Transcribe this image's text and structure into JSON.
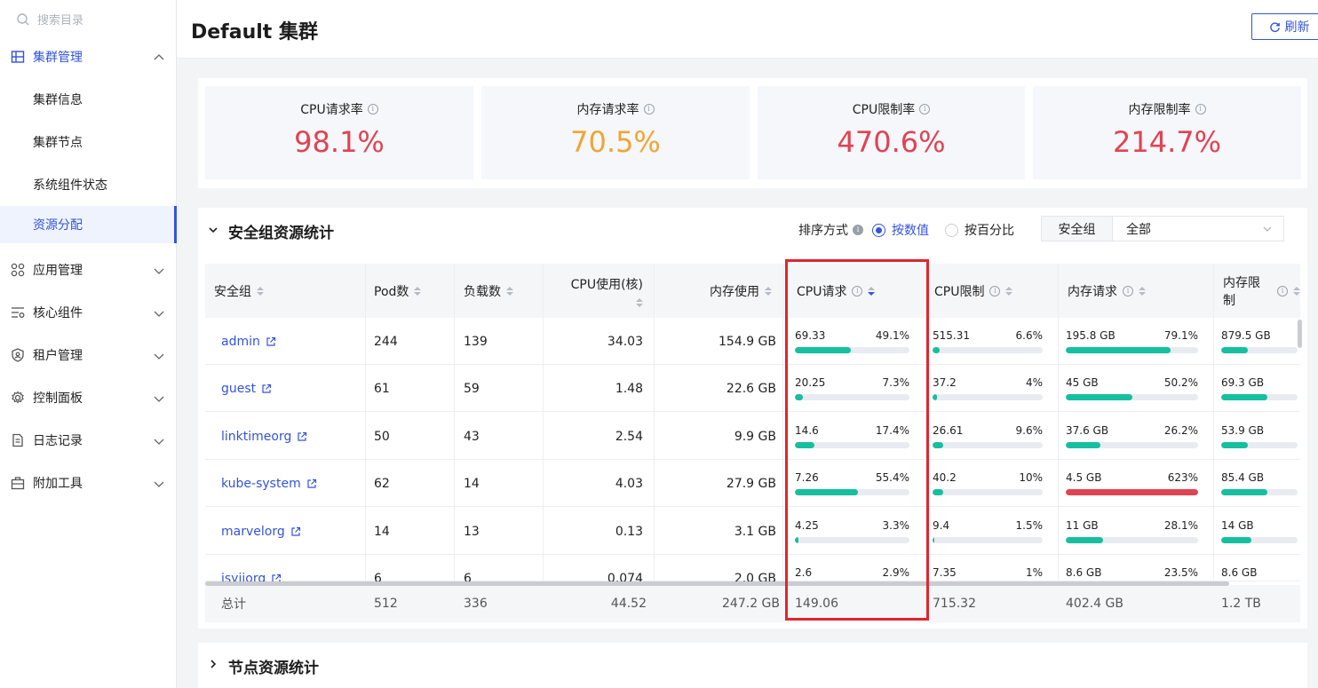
{
  "sidebar": {
    "search_placeholder": "搜索目录",
    "groups": [
      {
        "label": "集群管理",
        "icon": "cluster-icon",
        "expanded": true
      },
      {
        "label": "应用管理",
        "icon": "apps-icon"
      },
      {
        "label": "核心组件",
        "icon": "components-icon"
      },
      {
        "label": "租户管理",
        "icon": "tenant-shield-icon"
      },
      {
        "label": "控制面板",
        "icon": "gear-icon"
      },
      {
        "label": "日志记录",
        "icon": "log-doc-icon"
      },
      {
        "label": "附加工具",
        "icon": "toolbox-icon"
      }
    ],
    "sub_items": [
      "集群信息",
      "集群节点",
      "系统组件状态",
      "资源分配"
    ],
    "selected": "资源分配"
  },
  "header": {
    "title": "Default 集群",
    "refresh_label": "刷新"
  },
  "stats": [
    {
      "label": "CPU请求率",
      "value": "98.1%",
      "color": "#e04352"
    },
    {
      "label": "内存请求率",
      "value": "70.5%",
      "color": "#f0a533"
    },
    {
      "label": "CPU限制率",
      "value": "470.6%",
      "color": "#e04352"
    },
    {
      "label": "内存限制率",
      "value": "214.7%",
      "color": "#e04352"
    }
  ],
  "security_section": {
    "title": "安全组资源统计",
    "sort_label": "排序方式",
    "sort_options": [
      "按数值",
      "按百分比"
    ],
    "sort_selected": "按数值",
    "filter_label": "安全组",
    "filter_value": "全部"
  },
  "table": {
    "columns": [
      "安全组",
      "Pod数",
      "负载数",
      "CPU使用(核)",
      "内存使用",
      "CPU请求",
      "CPU限制",
      "内存请求",
      "内存限制"
    ],
    "rows": [
      {
        "name": "admin",
        "pods": "244",
        "loads": "139",
        "cpu_use": "34.03",
        "mem_use": "154.9 GB",
        "cpu_req": [
          "69.33",
          "49.1%",
          0.491
        ],
        "cpu_lim": [
          "515.31",
          "6.6%",
          0.066
        ],
        "mem_req": [
          "195.8 GB",
          "79.1%",
          0.791
        ],
        "mem_lim": [
          "879.5 GB",
          "",
          0.35
        ]
      },
      {
        "name": "guest",
        "pods": "61",
        "loads": "59",
        "cpu_use": "1.48",
        "mem_use": "22.6 GB",
        "cpu_req": [
          "20.25",
          "7.3%",
          0.073
        ],
        "cpu_lim": [
          "37.2",
          "4%",
          0.04
        ],
        "mem_req": [
          "45 GB",
          "50.2%",
          0.502
        ],
        "mem_lim": [
          "69.3 GB",
          "",
          0.6
        ]
      },
      {
        "name": "linktimeorg",
        "pods": "50",
        "loads": "43",
        "cpu_use": "2.54",
        "mem_use": "9.9 GB",
        "cpu_req": [
          "14.6",
          "17.4%",
          0.174
        ],
        "cpu_lim": [
          "26.61",
          "9.6%",
          0.096
        ],
        "mem_req": [
          "37.6 GB",
          "26.2%",
          0.262
        ],
        "mem_lim": [
          "53.9 GB",
          "",
          0.35
        ]
      },
      {
        "name": "kube-system",
        "pods": "62",
        "loads": "14",
        "cpu_use": "4.03",
        "mem_use": "27.9 GB",
        "cpu_req": [
          "7.26",
          "55.4%",
          0.554
        ],
        "cpu_lim": [
          "40.2",
          "10%",
          0.1
        ],
        "mem_req": [
          "4.5 GB",
          "623%",
          1.0
        ],
        "mem_lim": [
          "85.4 GB",
          "",
          0.6
        ]
      },
      {
        "name": "marvelorg",
        "pods": "14",
        "loads": "13",
        "cpu_use": "0.13",
        "mem_use": "3.1 GB",
        "cpu_req": [
          "4.25",
          "3.3%",
          0.033
        ],
        "cpu_lim": [
          "9.4",
          "1.5%",
          0.015
        ],
        "mem_req": [
          "11 GB",
          "28.1%",
          0.281
        ],
        "mem_lim": [
          "14 GB",
          "",
          0.4
        ]
      },
      {
        "name": "isyjjorg",
        "pods": "6",
        "loads": "6",
        "cpu_use": "0.074",
        "mem_use": "2.0 GB",
        "cpu_req": [
          "2.6",
          "2.9%",
          0.029
        ],
        "cpu_lim": [
          "7.35",
          "1%",
          0.01
        ],
        "mem_req": [
          "8.6 GB",
          "23.5%",
          0.235
        ],
        "mem_lim": [
          "8.6 GB",
          "",
          0.2
        ]
      }
    ],
    "total": {
      "label": "总计",
      "pods": "512",
      "loads": "336",
      "cpu_use": "44.52",
      "mem_use": "247.2 GB",
      "cpu_req": "149.06",
      "cpu_lim": "715.32",
      "mem_req": "402.4 GB",
      "mem_lim": "1.2 TB"
    }
  },
  "node_section": {
    "title": "节点资源统计"
  },
  "colors": {
    "accent": "#3354d9",
    "bar_ok": "#16bf9f",
    "bar_over": "#e04352",
    "highlight": "#e0262e"
  }
}
